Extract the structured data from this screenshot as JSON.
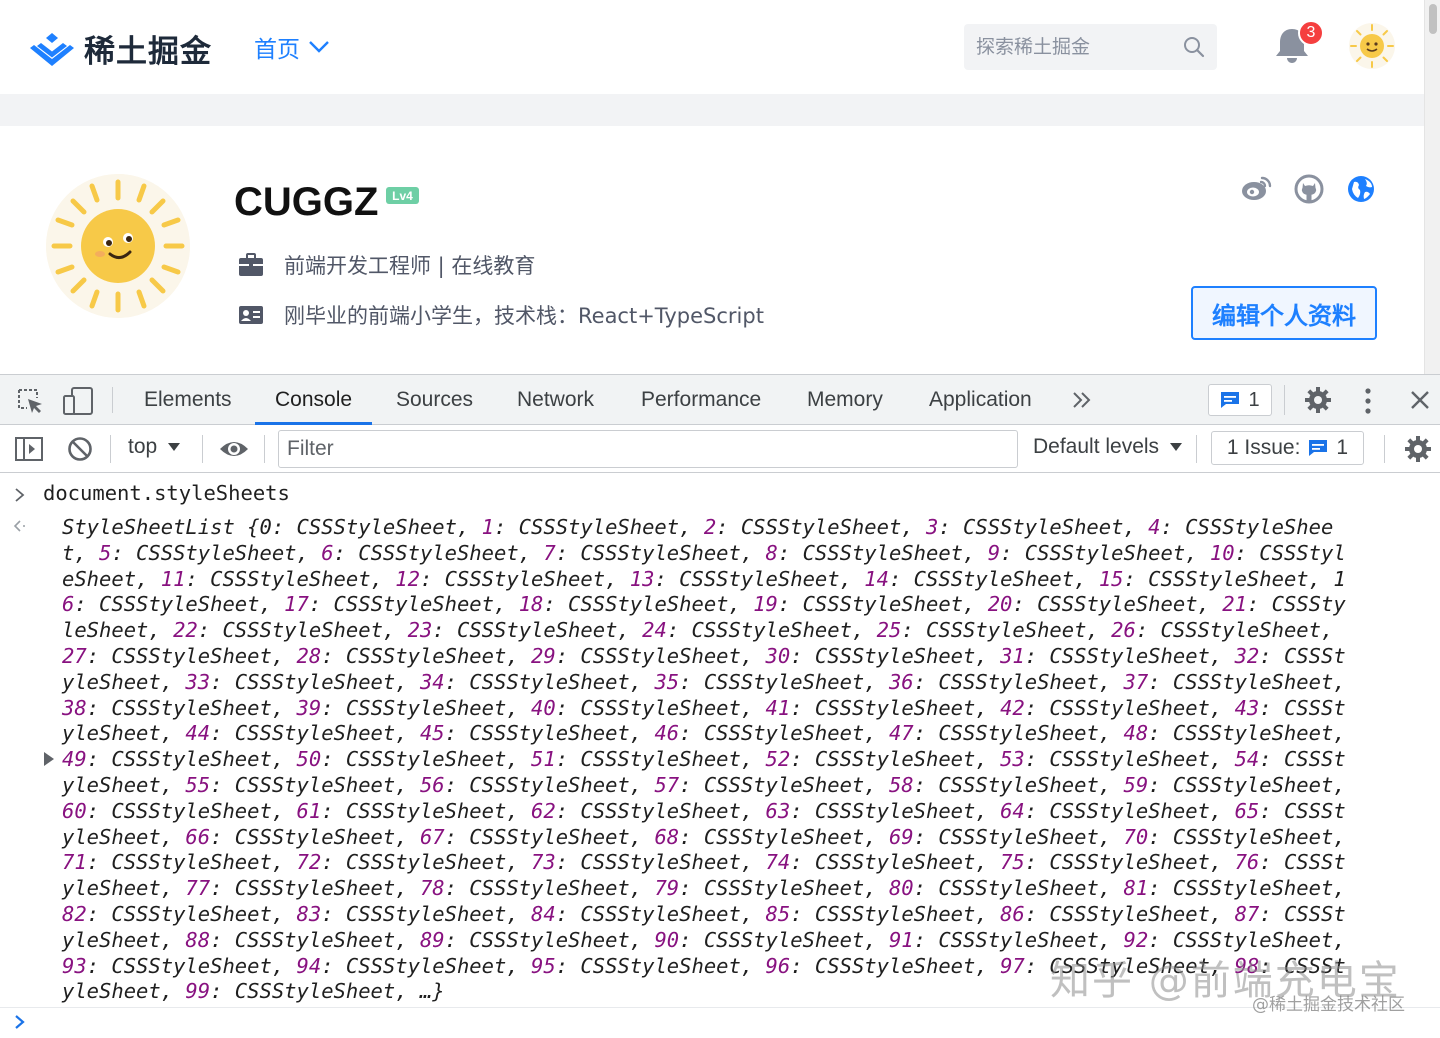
{
  "site": {
    "logo_text": "稀土掘金",
    "nav_home": "首页",
    "search_placeholder": "探索稀土掘金",
    "notification_count": "3"
  },
  "profile": {
    "username": "CUGGZ",
    "level": "Lv4",
    "job": "前端开发工程师 | 在线教育",
    "bio": "刚毕业的前端小学生，技术栈：React+TypeScript",
    "edit_button": "编辑个人资料",
    "social_icons": [
      "weibo-icon",
      "github-icon",
      "website-icon"
    ]
  },
  "devtools": {
    "tabs": [
      "Elements",
      "Console",
      "Sources",
      "Network",
      "Performance",
      "Memory",
      "Application"
    ],
    "active_tab": "Console",
    "message_count": "1",
    "context": "top",
    "filter_placeholder": "Filter",
    "default_levels": "Default levels",
    "issues_label": "1 Issue:",
    "issues_count": "1"
  },
  "console": {
    "command": "document.styleSheets",
    "result_lines": [
      "StyleSheetList {0: CSSStyleSheet, 1: CSSStyleSheet, 2: CSSStyleSheet, 3: CSSStyleSheet, 4: CSSStyleShee",
      "t, 5: CSSStyleSheet, 6: CSSStyleSheet, 7: CSSStyleSheet, 8: CSSStyleSheet, 9: CSSStyleSheet, 10: CSSStyl",
      "eSheet, 11: CSSStyleSheet, 12: CSSStyleSheet, 13: CSSStyleSheet, 14: CSSStyleSheet, 15: CSSStyleSheet, 1",
      "6: CSSStyleSheet, 17: CSSStyleSheet, 18: CSSStyleSheet, 19: CSSStyleSheet, 20: CSSStyleSheet, 21: CSSSty",
      "leSheet, 22: CSSStyleSheet, 23: CSSStyleSheet, 24: CSSStyleSheet, 25: CSSStyleSheet, 26: CSSStyleSheet,",
      "27: CSSStyleSheet, 28: CSSStyleSheet, 29: CSSStyleSheet, 30: CSSStyleSheet, 31: CSSStyleSheet, 32: CSSSt",
      "yleSheet, 33: CSSStyleSheet, 34: CSSStyleSheet, 35: CSSStyleSheet, 36: CSSStyleSheet, 37: CSSStyleSheet,",
      "38: CSSStyleSheet, 39: CSSStyleSheet, 40: CSSStyleSheet, 41: CSSStyleSheet, 42: CSSStyleSheet, 43: CSSSt",
      "yleSheet, 44: CSSStyleSheet, 45: CSSStyleSheet, 46: CSSStyleSheet, 47: CSSStyleSheet, 48: CSSStyleSheet,",
      "49: CSSStyleSheet, 50: CSSStyleSheet, 51: CSSStyleSheet, 52: CSSStyleSheet, 53: CSSStyleSheet, 54: CSSSt",
      "yleSheet, 55: CSSStyleSheet, 56: CSSStyleSheet, 57: CSSStyleSheet, 58: CSSStyleSheet, 59: CSSStyleSheet,",
      "60: CSSStyleSheet, 61: CSSStyleSheet, 62: CSSStyleSheet, 63: CSSStyleSheet, 64: CSSStyleSheet, 65: CSSSt",
      "yleSheet, 66: CSSStyleSheet, 67: CSSStyleSheet, 68: CSSStyleSheet, 69: CSSStyleSheet, 70: CSSStyleSheet,",
      "71: CSSStyleSheet, 72: CSSStyleSheet, 73: CSSStyleSheet, 74: CSSStyleSheet, 75: CSSStyleSheet, 76: CSSSt",
      "yleSheet, 77: CSSStyleSheet, 78: CSSStyleSheet, 79: CSSStyleSheet, 80: CSSStyleSheet, 81: CSSStyleSheet,",
      "82: CSSStyleSheet, 83: CSSStyleSheet, 84: CSSStyleSheet, 85: CSSStyleSheet, 86: CSSStyleSheet, 87: CSSSt",
      "yleSheet, 88: CSSStyleSheet, 89: CSSStyleSheet, 90: CSSStyleSheet, 91: CSSStyleSheet, 92: CSSStyleSheet,",
      "93: CSSStyleSheet, 94: CSSStyleSheet, 95: CSSStyleSheet, 96: CSSStyleSheet, 97: CSSStyleSheet, 98: CSSSt",
      "yleSheet, 99: CSSStyleSheet, …}"
    ]
  },
  "watermark": {
    "main": "知乎 @前端充电宝",
    "sub": "@稀土掘金技术社区"
  },
  "colors": {
    "brand_blue": "#1e80ff",
    "devtools_active": "#1a73e8",
    "console_key": "#881280",
    "badge_red": "#f53f3f"
  }
}
